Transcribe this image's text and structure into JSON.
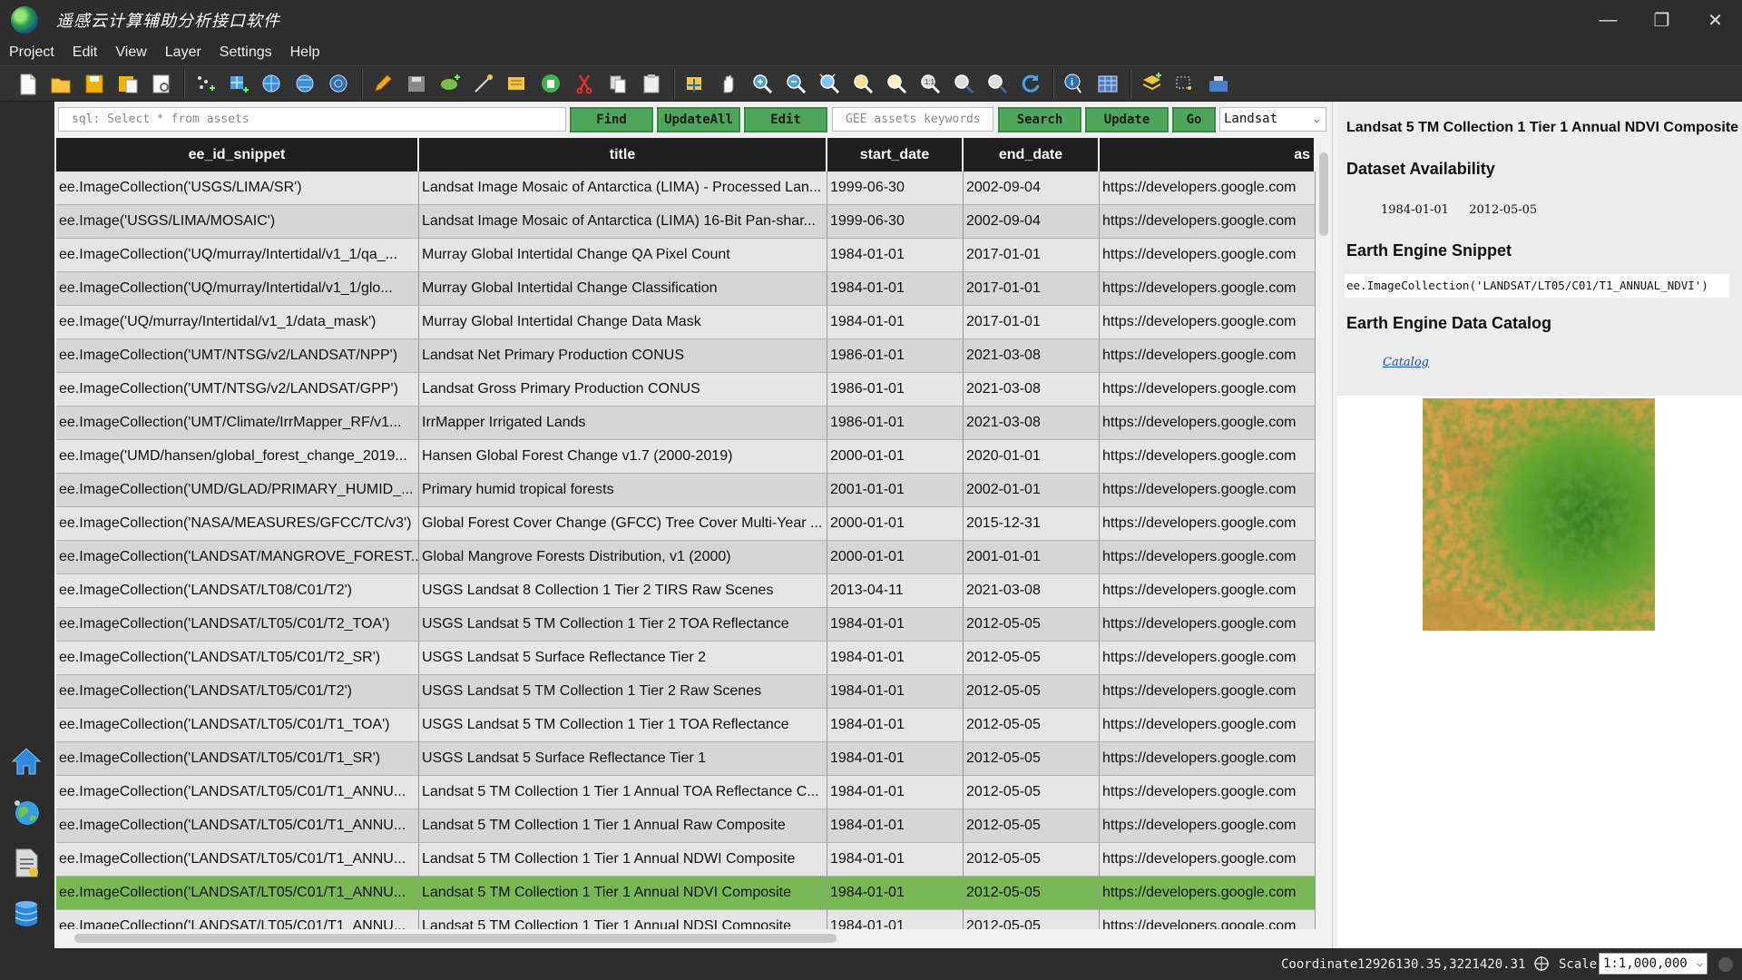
{
  "window": {
    "title": "遥感云计算辅助分析接口软件",
    "minimize": "—",
    "maximize": "❐",
    "close": "✕"
  },
  "menu": [
    "Project",
    "Edit",
    "View",
    "Layer",
    "Settings",
    "Help"
  ],
  "query_bar": {
    "sql_placeholder": "sql: Select * from assets",
    "find_label": "Find",
    "update_all_label": "UpdateAll",
    "edit_label": "Edit",
    "keywords_placeholder": "GEE assets keywords",
    "search_label": "Search",
    "update_label": "Update",
    "go_label": "Go",
    "collection_value": "Landsat"
  },
  "table": {
    "columns": [
      "ee_id_snippet",
      "title",
      "start_date",
      "end_date",
      "as"
    ],
    "selected_index": 21,
    "rows": [
      [
        "ee.ImageCollection('USGS/LIMA/SR')",
        "Landsat Image Mosaic of Antarctica (LIMA) - Processed Lan...",
        "1999-06-30",
        "2002-09-04",
        "https://developers.google.com"
      ],
      [
        "ee.Image('USGS/LIMA/MOSAIC')",
        "Landsat Image Mosaic of Antarctica (LIMA) 16-Bit Pan-shar...",
        "1999-06-30",
        "2002-09-04",
        "https://developers.google.com"
      ],
      [
        "ee.ImageCollection('UQ/murray/Intertidal/v1_1/qa_...",
        "Murray Global Intertidal Change QA Pixel Count",
        "1984-01-01",
        "2017-01-01",
        "https://developers.google.com"
      ],
      [
        "ee.ImageCollection('UQ/murray/Intertidal/v1_1/glo...",
        "Murray Global Intertidal Change Classification",
        "1984-01-01",
        "2017-01-01",
        "https://developers.google.com"
      ],
      [
        "ee.Image('UQ/murray/Intertidal/v1_1/data_mask')",
        "Murray Global Intertidal Change Data Mask",
        "1984-01-01",
        "2017-01-01",
        "https://developers.google.com"
      ],
      [
        "ee.ImageCollection('UMT/NTSG/v2/LANDSAT/NPP')",
        "Landsat Net Primary Production CONUS",
        "1986-01-01",
        "2021-03-08",
        "https://developers.google.com"
      ],
      [
        "ee.ImageCollection('UMT/NTSG/v2/LANDSAT/GPP')",
        "Landsat Gross Primary Production CONUS",
        "1986-01-01",
        "2021-03-08",
        "https://developers.google.com"
      ],
      [
        "ee.ImageCollection('UMT/Climate/IrrMapper_RF/v1...",
        "IrrMapper Irrigated Lands",
        "1986-01-01",
        "2021-03-08",
        "https://developers.google.com"
      ],
      [
        "ee.Image('UMD/hansen/global_forest_change_2019...",
        "Hansen Global Forest Change v1.7 (2000-2019)",
        "2000-01-01",
        "2020-01-01",
        "https://developers.google.com"
      ],
      [
        "ee.ImageCollection('UMD/GLAD/PRIMARY_HUMID_...",
        "Primary humid tropical forests",
        "2001-01-01",
        "2002-01-01",
        "https://developers.google.com"
      ],
      [
        "ee.ImageCollection('NASA/MEASURES/GFCC/TC/v3')",
        "Global Forest Cover Change (GFCC) Tree Cover Multi-Year ...",
        "2000-01-01",
        "2015-12-31",
        "https://developers.google.com"
      ],
      [
        "ee.ImageCollection('LANDSAT/MANGROVE_FOREST...",
        "Global Mangrove Forests Distribution, v1 (2000)",
        "2000-01-01",
        "2001-01-01",
        "https://developers.google.com"
      ],
      [
        "ee.ImageCollection('LANDSAT/LT08/C01/T2')",
        "USGS Landsat 8 Collection 1 Tier 2 TIRS Raw Scenes",
        "2013-04-11",
        "2021-03-08",
        "https://developers.google.com"
      ],
      [
        "ee.ImageCollection('LANDSAT/LT05/C01/T2_TOA')",
        "USGS Landsat 5 TM Collection 1 Tier 2 TOA Reflectance",
        "1984-01-01",
        "2012-05-05",
        "https://developers.google.com"
      ],
      [
        "ee.ImageCollection('LANDSAT/LT05/C01/T2_SR')",
        "USGS Landsat 5 Surface Reflectance Tier 2",
        "1984-01-01",
        "2012-05-05",
        "https://developers.google.com"
      ],
      [
        "ee.ImageCollection('LANDSAT/LT05/C01/T2')",
        "USGS Landsat 5 TM Collection 1 Tier 2 Raw Scenes",
        "1984-01-01",
        "2012-05-05",
        "https://developers.google.com"
      ],
      [
        "ee.ImageCollection('LANDSAT/LT05/C01/T1_TOA')",
        "USGS Landsat 5 TM Collection 1 Tier 1 TOA Reflectance",
        "1984-01-01",
        "2012-05-05",
        "https://developers.google.com"
      ],
      [
        "ee.ImageCollection('LANDSAT/LT05/C01/T1_SR')",
        "USGS Landsat 5 Surface Reflectance Tier 1",
        "1984-01-01",
        "2012-05-05",
        "https://developers.google.com"
      ],
      [
        "ee.ImageCollection('LANDSAT/LT05/C01/T1_ANNU...",
        "Landsat 5 TM Collection 1 Tier 1 Annual TOA Reflectance C...",
        "1984-01-01",
        "2012-05-05",
        "https://developers.google.com"
      ],
      [
        "ee.ImageCollection('LANDSAT/LT05/C01/T1_ANNU...",
        "Landsat 5 TM Collection 1 Tier 1 Annual Raw Composite",
        "1984-01-01",
        "2012-05-05",
        "https://developers.google.com"
      ],
      [
        "ee.ImageCollection('LANDSAT/LT05/C01/T1_ANNU...",
        "Landsat 5 TM Collection 1 Tier 1 Annual NDWI Composite",
        "1984-01-01",
        "2012-05-05",
        "https://developers.google.com"
      ],
      [
        "ee.ImageCollection('LANDSAT/LT05/C01/T1_ANNU...",
        "Landsat 5 TM Collection 1 Tier 1 Annual NDVI Composite",
        "1984-01-01",
        "2012-05-05",
        "https://developers.google.com"
      ],
      [
        "ee.ImageCollection('LANDSAT/LT05/C01/T1_ANNU...",
        "Landsat 5 TM Collection 1 Tier 1 Annual NDSI Composite",
        "1984-01-01",
        "2012-05-05",
        "https://developers.google.com"
      ]
    ]
  },
  "info": {
    "title": "Landsat 5 TM Collection 1 Tier 1 Annual NDVI Composite",
    "availability_heading": "Dataset Availability",
    "start": "1984-01-01",
    "end": "2012-05-05",
    "snippet_heading": "Earth Engine Snippet",
    "snippet": "ee.ImageCollection('LANDSAT/LT05/C01/T1_ANNUAL_NDVI')",
    "catalog_heading": "Earth Engine Data Catalog",
    "catalog_link": "Catalog"
  },
  "status": {
    "coordinate_label": "Coordinate",
    "coordinate_value": "12926130.35,3221420.31",
    "scale_label": "Scale",
    "scale_value": "1:1,000,000"
  },
  "icons": {
    "toolbar": [
      "new-file-icon",
      "open-folder-icon",
      "save-icon",
      "save-as-icon",
      "print-preview-icon",
      "add-point-layer-icon",
      "add-grid-layer-icon",
      "add-wms-icon",
      "add-wfs-icon",
      "add-wcs-icon",
      "edit-pencil-icon",
      "save-edits-icon",
      "add-feature-icon",
      "digitize-icon",
      "attribute-table-edit-icon",
      "delete-icon",
      "cut-icon",
      "copy-icon",
      "paste-icon",
      "pan-to-selection-icon",
      "pan-hand-icon",
      "zoom-in-icon",
      "zoom-out-icon",
      "zoom-full-icon",
      "zoom-to-layer-icon",
      "zoom-to-selection-icon",
      "zoom-native-icon",
      "zoom-last-icon",
      "zoom-next-icon",
      "refresh-icon",
      "identify-icon",
      "table-icon",
      "layer-properties-icon",
      "select-features-icon",
      "map-tips-icon"
    ],
    "dock": [
      "home-icon",
      "earth-engine-icon",
      "document-script-icon",
      "database-icon"
    ]
  },
  "colors": {
    "button_green": "#4ea65a",
    "selected_row": "#78b955",
    "header_bg": "#1e1e1e",
    "chrome_dark": "#2d2d2d"
  }
}
